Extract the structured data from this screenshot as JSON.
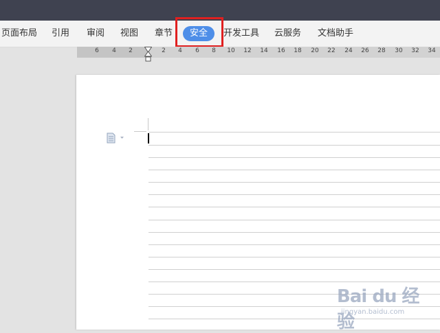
{
  "menu": {
    "items": [
      {
        "label": "页面布局",
        "active": false
      },
      {
        "label": "引用",
        "active": false
      },
      {
        "label": "审阅",
        "active": false
      },
      {
        "label": "视图",
        "active": false
      },
      {
        "label": "章节",
        "active": false
      },
      {
        "label": "安全",
        "active": true
      },
      {
        "label": "开发工具",
        "active": false
      },
      {
        "label": "云服务",
        "active": false
      },
      {
        "label": "文档助手",
        "active": false
      }
    ]
  },
  "ruler": {
    "labels": [
      "6",
      "4",
      "2",
      "2",
      "4",
      "6",
      "8",
      "10",
      "12",
      "14",
      "16",
      "18",
      "20",
      "22",
      "24",
      "26",
      "28",
      "30",
      "32",
      "34"
    ]
  },
  "watermark": {
    "logo": "Bai du 经验",
    "url": "jingyan.baidu.com"
  },
  "colors": {
    "accent": "#4e8ee8",
    "highlight": "#e02020",
    "topbar": "#3f4250"
  }
}
